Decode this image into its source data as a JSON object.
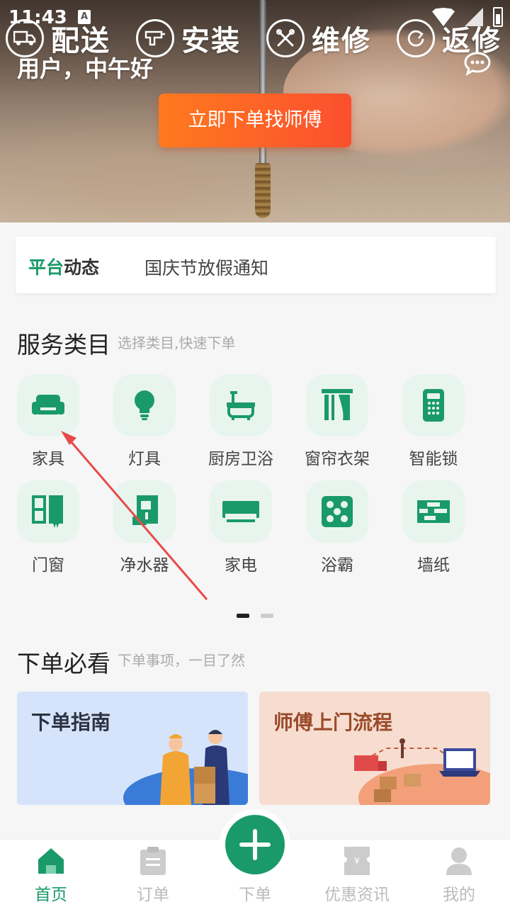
{
  "status_bar": {
    "time": "11:43",
    "notification_icon": "A"
  },
  "hero": {
    "services": [
      {
        "label": "配送",
        "icon": "truck-icon"
      },
      {
        "label": "安装",
        "icon": "drill-icon"
      },
      {
        "label": "维修",
        "icon": "tools-icon"
      },
      {
        "label": "返修",
        "icon": "refresh-icon"
      }
    ],
    "greeting": "用户，中午好",
    "order_button": "立即下单找师傅"
  },
  "notice": {
    "tag_part1": "平台",
    "tag_part2": "动态",
    "text": "国庆节放假通知"
  },
  "categories": {
    "title": "服务类目",
    "subtitle": "选择类目,快速下单",
    "items": [
      {
        "label": "家具",
        "icon": "sofa-icon"
      },
      {
        "label": "灯具",
        "icon": "bulb-icon"
      },
      {
        "label": "厨房卫浴",
        "icon": "bathtub-icon"
      },
      {
        "label": "窗帘衣架",
        "icon": "curtain-icon"
      },
      {
        "label": "智能锁",
        "icon": "smart-lock-icon"
      },
      {
        "label": "门窗",
        "icon": "door-window-icon"
      },
      {
        "label": "净水器",
        "icon": "water-purifier-icon"
      },
      {
        "label": "家电",
        "icon": "air-conditioner-icon"
      },
      {
        "label": "浴霸",
        "icon": "bath-heater-icon"
      },
      {
        "label": "墙纸",
        "icon": "wallpaper-icon"
      }
    ]
  },
  "guide": {
    "title": "下单必看",
    "subtitle": "下单事项，一目了然",
    "cards": [
      {
        "title": "下单指南"
      },
      {
        "title": "师傅上门流程"
      }
    ]
  },
  "bottom_nav": {
    "items": [
      {
        "label": "首页",
        "icon": "home-icon",
        "active": true
      },
      {
        "label": "订单",
        "icon": "clipboard-icon",
        "active": false
      },
      {
        "label": "下单",
        "icon": "plus-icon",
        "active": false
      },
      {
        "label": "优惠资讯",
        "icon": "coupon-icon",
        "active": false
      },
      {
        "label": "我的",
        "icon": "user-icon",
        "active": false
      }
    ]
  },
  "colors": {
    "brand": "#1a9a6a",
    "order_button": "#fb4f2f",
    "icon_bg": "#e8f5ef"
  }
}
